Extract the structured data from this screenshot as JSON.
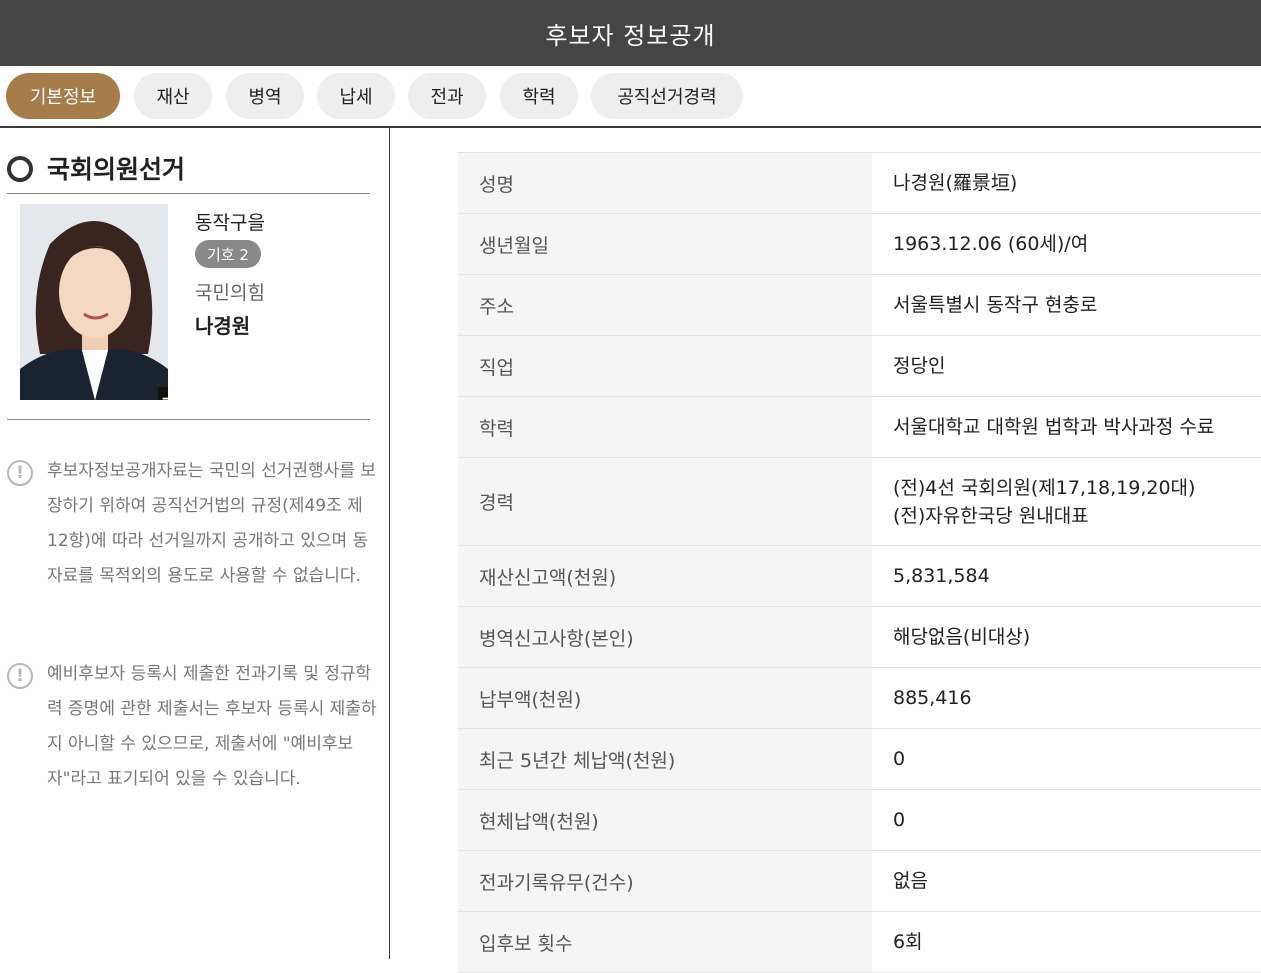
{
  "header": {
    "title": "후보자 정보공개"
  },
  "tabs": [
    {
      "label": "기본정보",
      "active": true
    },
    {
      "label": "재산"
    },
    {
      "label": "병역"
    },
    {
      "label": "납세"
    },
    {
      "label": "전과"
    },
    {
      "label": "학력"
    },
    {
      "label": "공직선거경력"
    }
  ],
  "election": {
    "title": "국회의원선거"
  },
  "candidate": {
    "district": "동작구을",
    "number": "기호 2",
    "party": "국민의힘",
    "name": "나경원",
    "photo_expand": "+"
  },
  "notices": [
    {
      "icon": "!",
      "text": "후보자정보공개자료는 국민의 선거권행사를 보장하기 위하여 공직선거법의 규정(제49조 제12항)에 따라 선거일까지 공개하고 있으며 동 자료를 목적외의 용도로 사용할 수 없습니다."
    },
    {
      "icon": "!",
      "text": "예비후보자 등록시 제출한 전과기록 및 정규학력 증명에 관한 제출서는 후보자 등록시 제출하지 아니할 수 있으므로, 제출서에 \"예비후보자\"라고 표기되어 있을 수 있습니다."
    }
  ],
  "info_rows": [
    {
      "label": "성명",
      "value": "나경원(羅景垣)"
    },
    {
      "label": "생년월일",
      "value": "1963.12.06 (60세)/여"
    },
    {
      "label": "주소",
      "value": "서울특별시 동작구 현충로"
    },
    {
      "label": "직업",
      "value": "정당인"
    },
    {
      "label": "학력",
      "value": "서울대학교 대학원 법학과 박사과정 수료"
    },
    {
      "label": "경력",
      "value": "(전)4선 국회의원(제17,18,19,20대)",
      "value2": "(전)자유한국당 원내대표"
    },
    {
      "label": "재산신고액(천원)",
      "value": "5,831,584"
    },
    {
      "label": "병역신고사항(본인)",
      "value": "해당없음(비대상)"
    },
    {
      "label": "납부액(천원)",
      "value": "885,416"
    },
    {
      "label": "최근 5년간 체납액(천원)",
      "value": "0"
    },
    {
      "label": "현체납액(천원)",
      "value": "0"
    },
    {
      "label": "전과기록유무(건수)",
      "value": "없음"
    },
    {
      "label": "입후보 횟수",
      "value": "6회"
    }
  ],
  "colors": {
    "header_bg": "#454545",
    "tab_active": "#a67c4a",
    "tab_inactive": "#eeeeee",
    "label_bg": "#f5f5f5"
  }
}
